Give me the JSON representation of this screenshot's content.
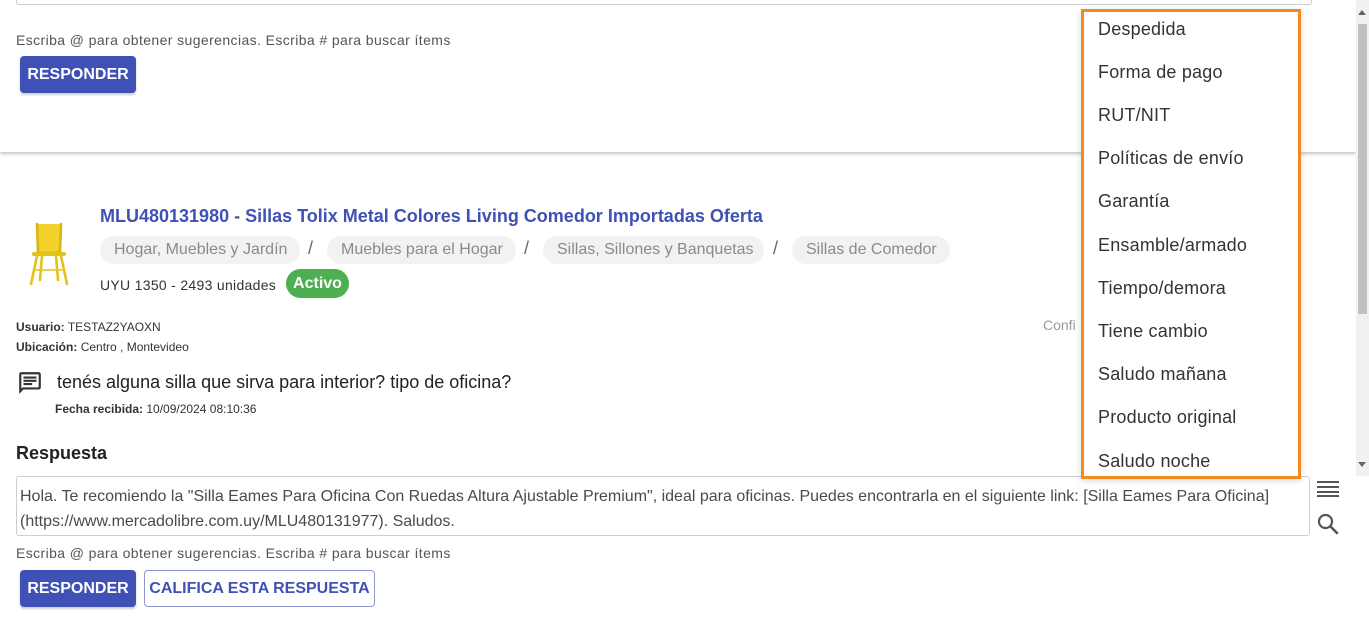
{
  "previous_question": {
    "hint": "Escriba @ para obtener sugerencias. Escriba # para buscar ítems",
    "reply_button": "RESPONDER"
  },
  "item": {
    "title": "MLU480131980 - Sillas Tolix Metal Colores Living Comedor Importadas Oferta",
    "breadcrumbs": [
      "Hogar, Muebles y Jardín",
      "Muebles para el Hogar",
      "Sillas, Sillones y Banquetas",
      "Sillas de Comedor"
    ],
    "breadcrumb_separator": "/",
    "price_stock": "UYU 1350 - 2493 unidades",
    "status": "Activo"
  },
  "user": {
    "user_label": "Usuario:",
    "user_value": "TESTAZ2YAOXN",
    "location_label": "Ubicación:",
    "location_value": "Centro , Montevideo",
    "partial_right_text": "Confi"
  },
  "question": {
    "text": "tenés alguna silla que sirva para interior? tipo de oficina?",
    "date_label": "Fecha recibida:",
    "date_value": "10/09/2024 08:10:36"
  },
  "answer": {
    "heading": "Respuesta",
    "text": "Hola. Te recomiendo la \"Silla Eames Para Oficina Con Ruedas Altura Ajustable Premium\", ideal para oficinas. Puedes encontrarla en el siguiente link: [Silla Eames Para Oficina] (https://www.mercadolibre.com.uy/MLU480131977). Saludos.",
    "hint": "Escriba @ para obtener sugerencias. Escriba # para buscar ítems",
    "reply_button": "RESPONDER",
    "rate_button": "CALIFICA ESTA RESPUESTA"
  },
  "template_menu": {
    "items": [
      "Despedida",
      "Forma de pago",
      "RUT/NIT",
      "Políticas de envío",
      "Garantía",
      "Ensamble/armado",
      "Tiempo/demora",
      "Tiene cambio",
      "Saludo mañana",
      "Producto original",
      "Saludo noche"
    ]
  },
  "colors": {
    "primary": "#3f51b5",
    "active_chip": "#4caf50",
    "highlight_border": "#f28a20"
  },
  "icons": {
    "chat": "chat-icon",
    "templates": "menu-lines-icon",
    "search": "search-icon",
    "product": "chair-icon"
  }
}
